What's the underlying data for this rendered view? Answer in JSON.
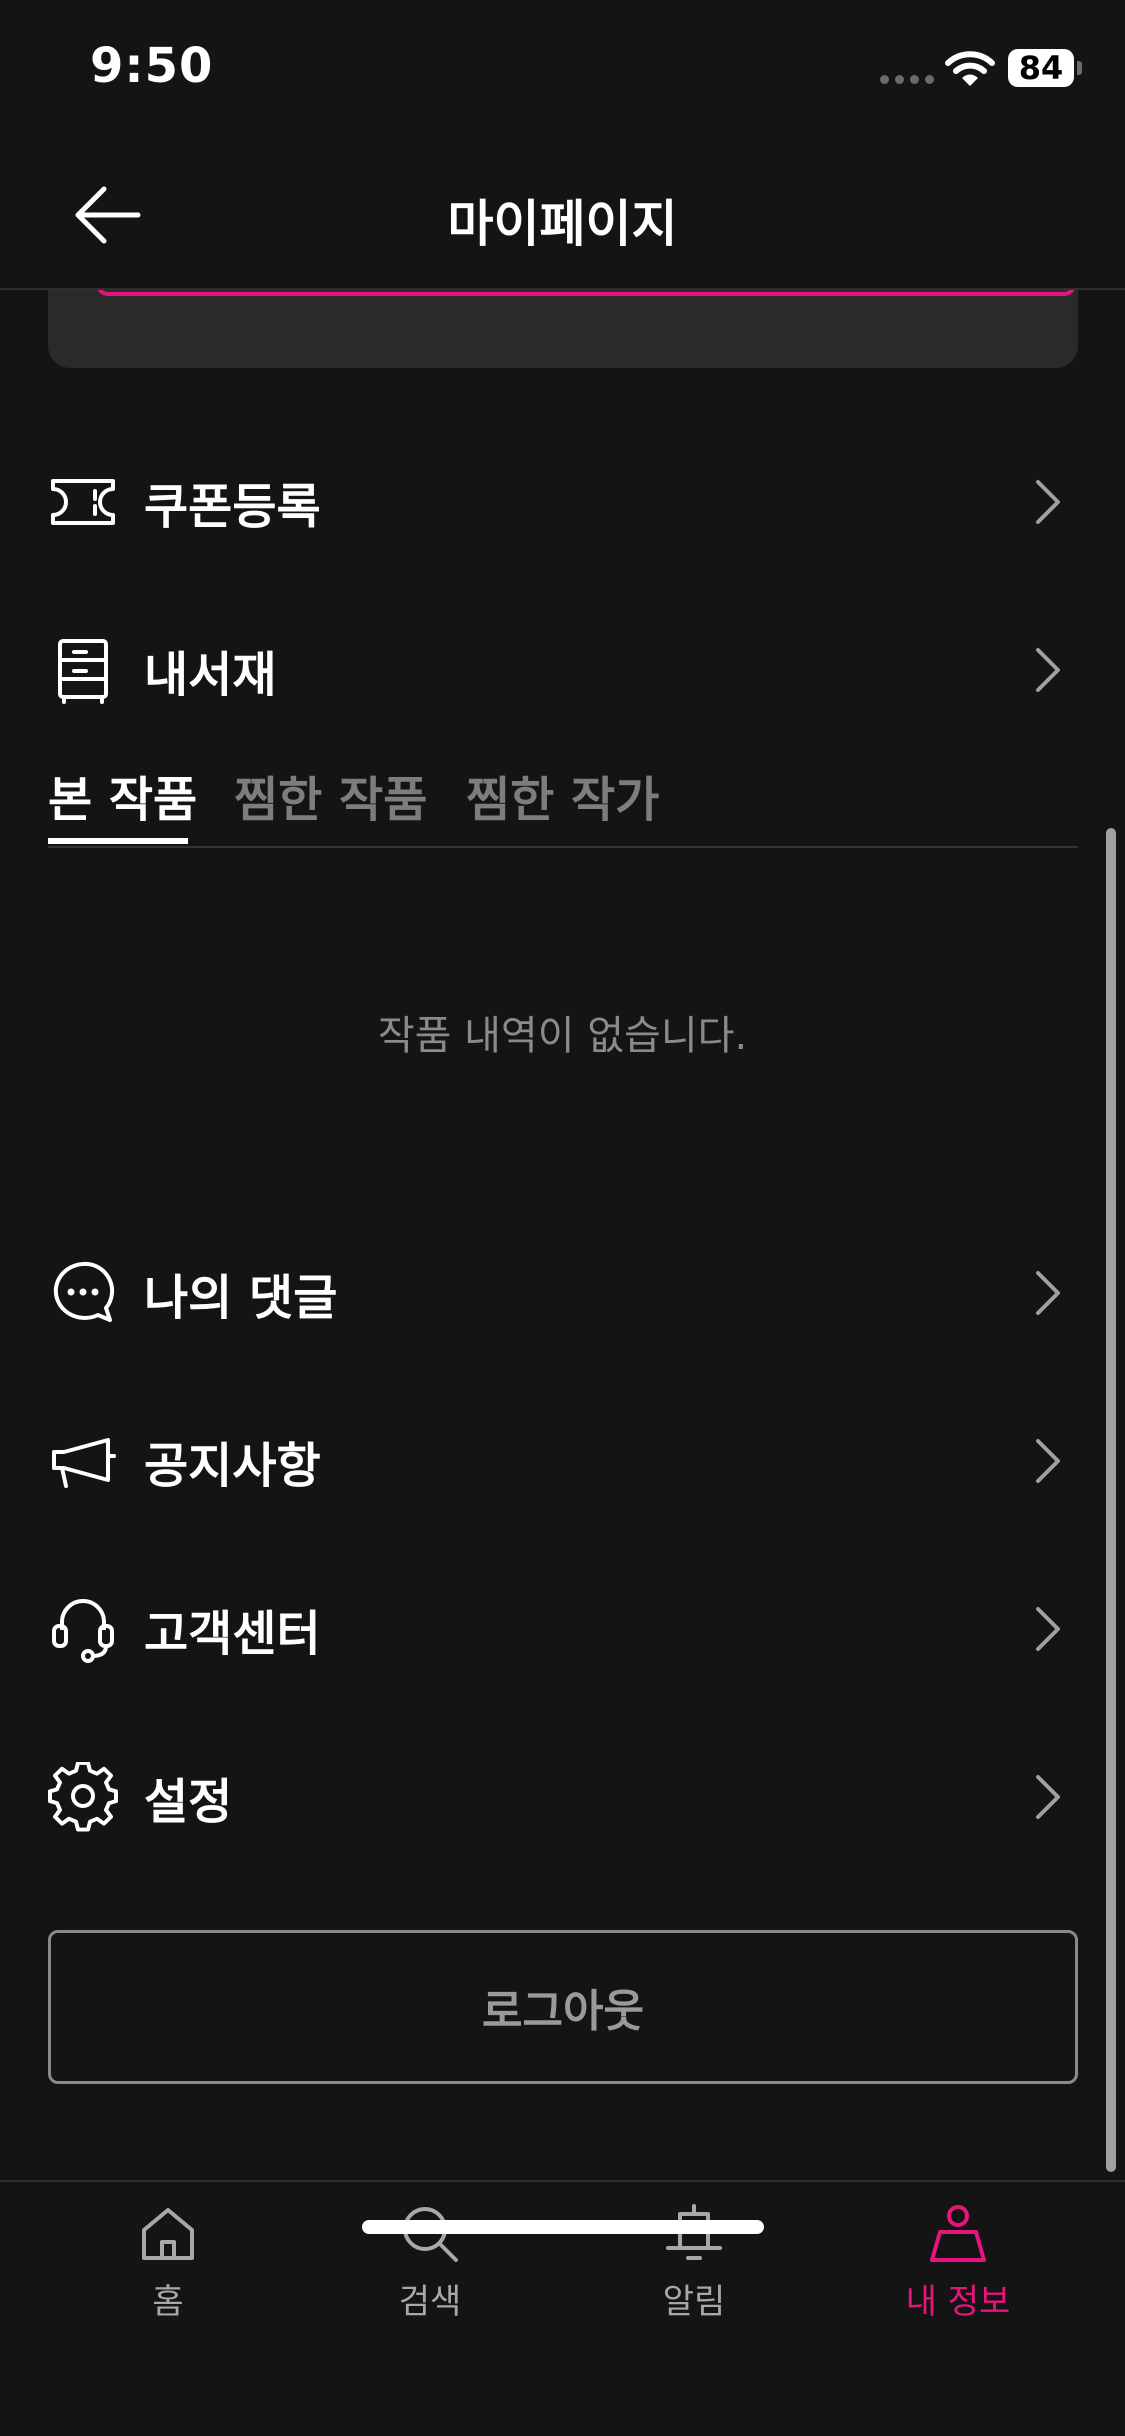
{
  "status_bar": {
    "time": "9:50",
    "battery": "84"
  },
  "header": {
    "title": "마이페이지"
  },
  "menu_top": [
    {
      "label": "쿠폰등록",
      "icon": "ticket-icon"
    },
    {
      "label": "내서재",
      "icon": "drawer-icon"
    }
  ],
  "tabs": [
    {
      "label": "본 작품",
      "active": true
    },
    {
      "label": "찜한 작품",
      "active": false
    },
    {
      "label": "찜한 작가",
      "active": false
    }
  ],
  "empty_message": "작품 내역이 없습니다.",
  "menu_bottom": [
    {
      "label": "나의 댓글",
      "icon": "chat-bubble-icon"
    },
    {
      "label": "공지사항",
      "icon": "megaphone-icon"
    },
    {
      "label": "고객센터",
      "icon": "headset-icon"
    },
    {
      "label": "설정",
      "icon": "gear-icon"
    }
  ],
  "logout_label": "로그아웃",
  "bottom_nav": [
    {
      "label": "홈",
      "icon": "home-icon",
      "active": false
    },
    {
      "label": "검색",
      "icon": "search-icon",
      "active": false
    },
    {
      "label": "알림",
      "icon": "bell-icon",
      "active": false
    },
    {
      "label": "내 정보",
      "icon": "person-icon",
      "active": true
    }
  ],
  "colors": {
    "accent": "#e6157e",
    "background": "#141414",
    "card": "#2a2a2a"
  }
}
